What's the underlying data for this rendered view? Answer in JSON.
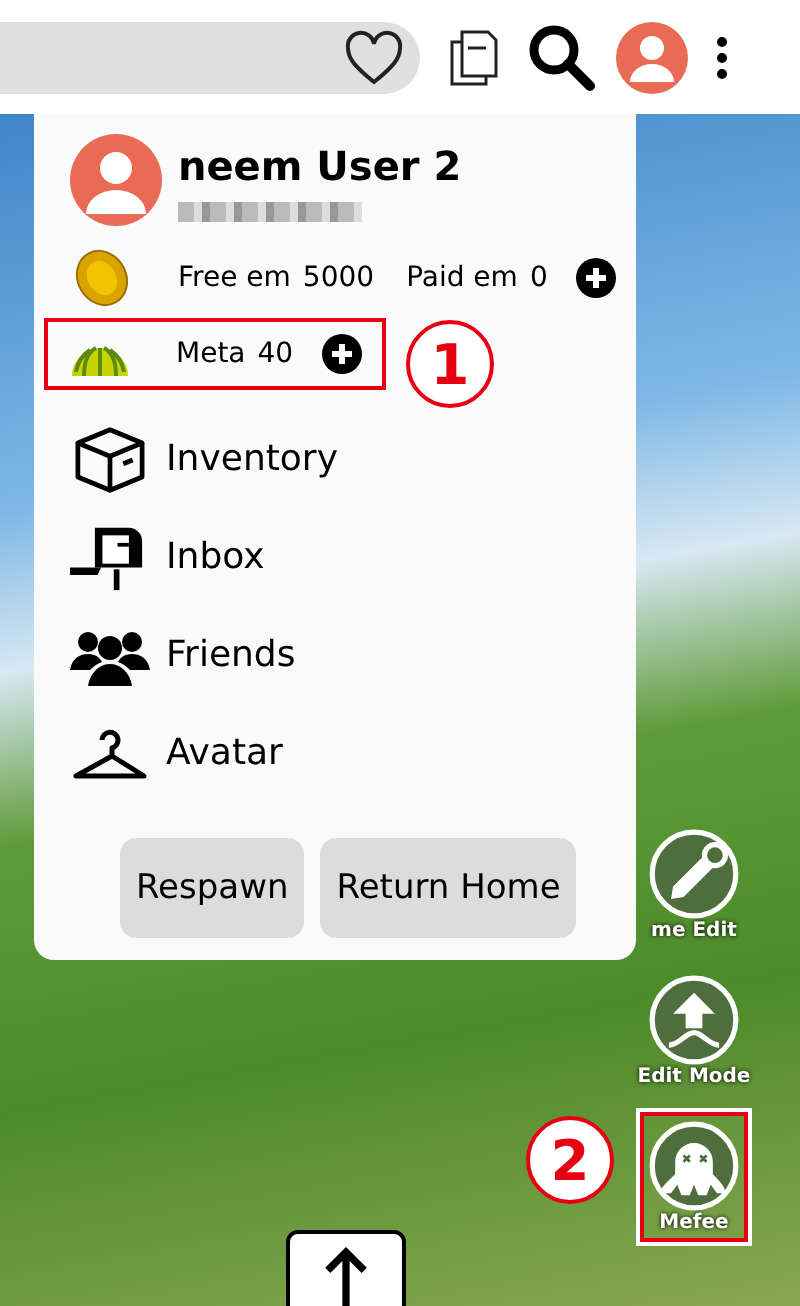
{
  "profile": {
    "name": "neem User 2"
  },
  "currency": {
    "free_label": "Free em",
    "free_value": "5000",
    "paid_label": "Paid em",
    "paid_value": "0"
  },
  "meta": {
    "label": "Meta",
    "value": "40"
  },
  "menu_items": [
    {
      "label": "Inventory"
    },
    {
      "label": "Inbox"
    },
    {
      "label": "Friends"
    },
    {
      "label": "Avatar"
    }
  ],
  "buttons": [
    "Respawn",
    "Return Home"
  ],
  "side_buttons": [
    {
      "label": "me Edit"
    },
    {
      "label": "Edit Mode"
    },
    {
      "label": "Mefee"
    }
  ],
  "annotations": [
    "1",
    "2"
  ]
}
